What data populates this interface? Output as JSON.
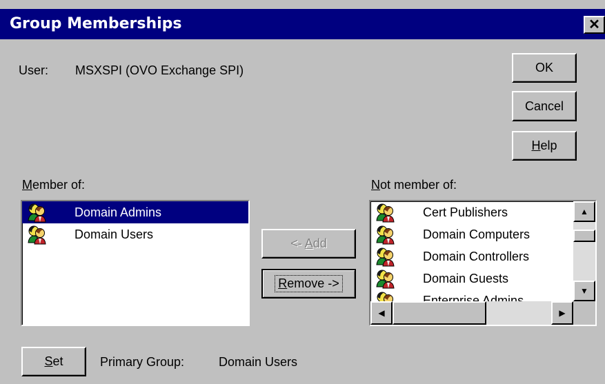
{
  "window": {
    "title": "Group Memberships",
    "close_label": "✕"
  },
  "user": {
    "label": "User:",
    "value": "MSXSPI (OVO Exchange SPI)"
  },
  "buttons": {
    "ok": "OK",
    "cancel": "Cancel",
    "help_u": "H",
    "help_rest": "elp",
    "add_pre": "<- ",
    "add_u": "A",
    "add_rest": "dd",
    "remove_u": "R",
    "remove_rest": "emove ->",
    "set_u": "S",
    "set_rest": "et"
  },
  "member_of": {
    "label_u": "M",
    "label_rest": "ember of:",
    "items": [
      {
        "name": "Domain Admins",
        "selected": true,
        "icon": "group-icon"
      },
      {
        "name": "Domain Users",
        "selected": false,
        "icon": "group-icon"
      }
    ]
  },
  "not_member_of": {
    "label_u": "N",
    "label_rest": "ot member of:",
    "items": [
      {
        "name": "Cert Publishers",
        "icon": "group-icon"
      },
      {
        "name": "Domain Computers",
        "icon": "group-icon"
      },
      {
        "name": "Domain Controllers",
        "icon": "group-icon"
      },
      {
        "name": "Domain Guests",
        "icon": "group-icon"
      },
      {
        "name": "Enterprise Admins",
        "icon": "group-icon"
      }
    ]
  },
  "primary_group": {
    "label": "Primary Group:",
    "value": "Domain Users"
  },
  "colors": {
    "titlebar": "#000080",
    "face": "#c0c0c0",
    "selection": "#000080"
  }
}
